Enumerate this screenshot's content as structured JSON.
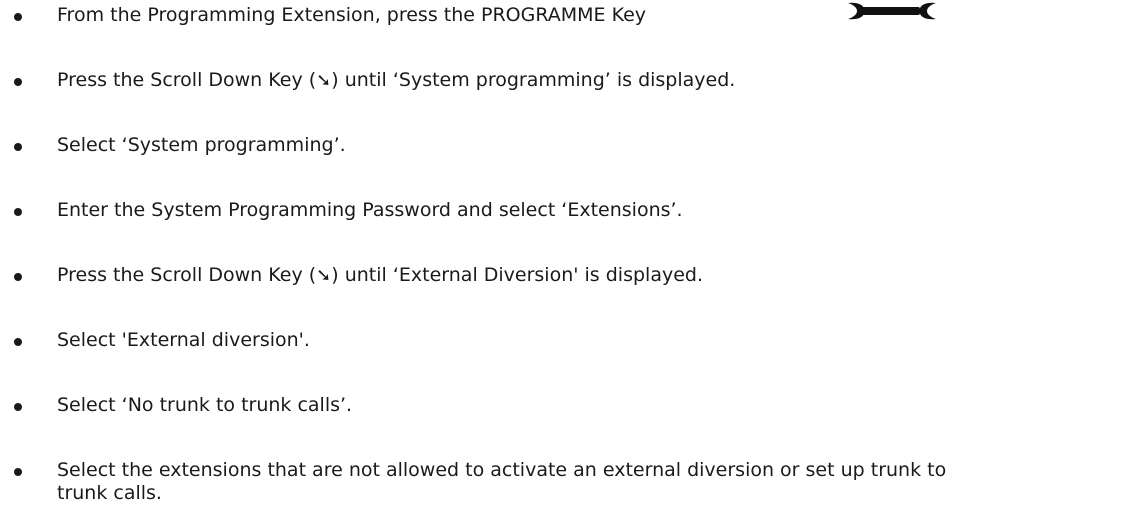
{
  "steps": [
    {
      "text": "From the Programming Extension, press the PROGRAMME Key"
    },
    {
      "before": "Press the Scroll Down Key (",
      "key": "➘",
      "after": ") until ‘System programming’ is displayed."
    },
    {
      "text": "Select ‘System programming’."
    },
    {
      "text": "Enter the System Programming Password and select ‘Extensions’."
    },
    {
      "before": "Press the Scroll Down Key (",
      "key": "➘",
      "after": ") until ‘External Diversion' is displayed."
    },
    {
      "text": "Select 'External diversion'."
    },
    {
      "text": "Select ‘No trunk to trunk calls’."
    },
    {
      "line1": "Select the extensions that are not allowed to activate an external diversion or set up trunk to",
      "line2": "trunk calls."
    }
  ],
  "icons": {
    "programme_key": "wrench-icon",
    "scroll_down_key": "scroll-down-arrow-icon"
  }
}
